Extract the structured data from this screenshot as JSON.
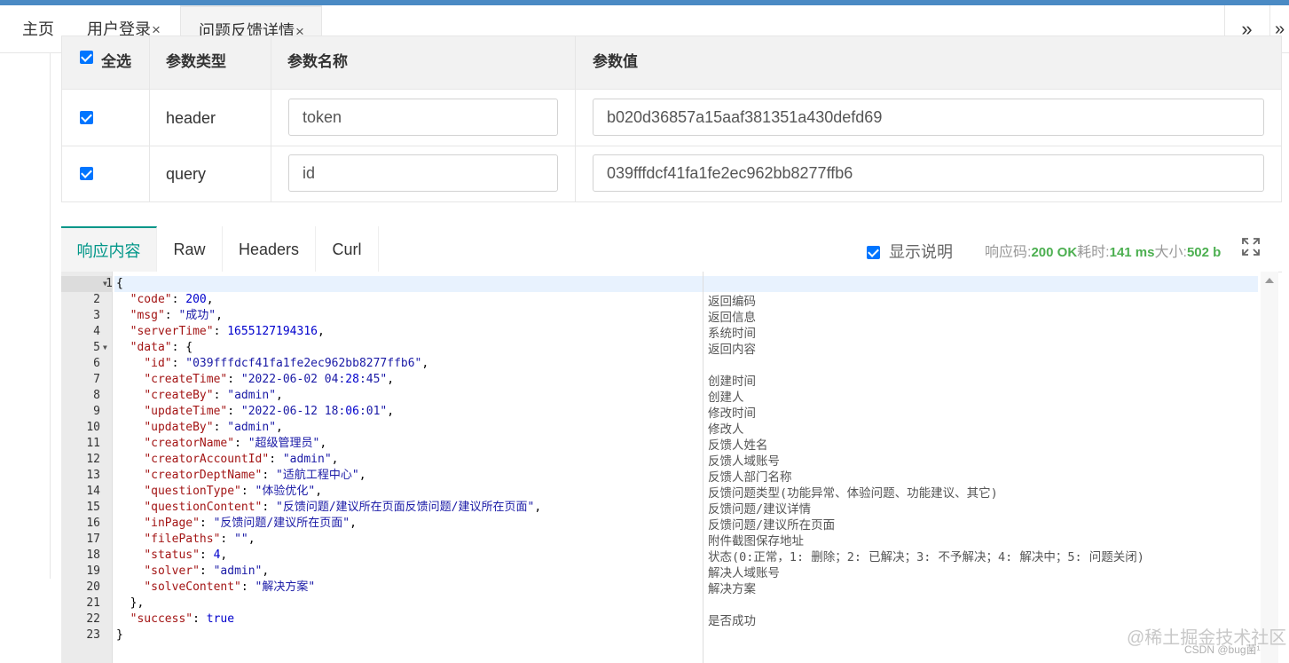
{
  "tabs": {
    "home": "主页",
    "login": "用户登录",
    "detail": "问题反馈详情",
    "close": "×",
    "more": "»",
    "more2": "»"
  },
  "params": {
    "headers": [
      "全选",
      "参数类型",
      "参数名称",
      "参数值"
    ],
    "rows": [
      {
        "type": "header",
        "name": "token",
        "value": "b020d36857a15aaf381351a430defd69"
      },
      {
        "type": "query",
        "name": "id",
        "value": "039fffdcf41fa1fe2ec962bb8277ffb6"
      }
    ]
  },
  "response": {
    "tabs": [
      "响应内容",
      "Raw",
      "Headers",
      "Curl"
    ],
    "show_desc": "显示说明",
    "status_label": "响应码:",
    "status_value": "200 OK",
    "time_label": "耗时:",
    "time_value": "141 ms",
    "size_label": "大小:",
    "size_value": "502 b"
  },
  "code_lines": [
    "{",
    "  \"code\": 200,",
    "  \"msg\": \"成功\",",
    "  \"serverTime\": 1655127194316,",
    "  \"data\": {",
    "    \"id\": \"039fffdcf41fa1fe2ec962bb8277ffb6\",",
    "    \"createTime\": \"2022-06-02 04:28:45\",",
    "    \"createBy\": \"admin\",",
    "    \"updateTime\": \"2022-06-12 18:06:01\",",
    "    \"updateBy\": \"admin\",",
    "    \"creatorName\": \"超级管理员\",",
    "    \"creatorAccountId\": \"admin\",",
    "    \"creatorDeptName\": \"适航工程中心\",",
    "    \"questionType\": \"体验优化\",",
    "    \"questionContent\": \"反馈问题/建议所在页面反馈问题/建议所在页面\",",
    "    \"inPage\": \"反馈问题/建议所在页面\",",
    "    \"filePaths\": \"\",",
    "    \"status\": 4,",
    "    \"solver\": \"admin\",",
    "    \"solveContent\": \"解决方案\"",
    "  },",
    "  \"success\": true",
    "}"
  ],
  "descriptions": [
    "",
    "返回编码",
    "返回信息",
    "系统时间",
    "返回内容",
    "",
    "创建时间",
    "创建人",
    "修改时间",
    "修改人",
    "反馈人姓名",
    "反馈人域账号",
    "反馈人部门名称",
    "反馈问题类型(功能异常、体验问题、功能建议、其它)",
    "反馈问题/建议详情",
    "反馈问题/建议所在页面",
    "附件截图保存地址",
    "状态(0:正常，1: 删除；2: 已解决；3: 不予解决；4: 解决中；5: 问题关闭)",
    "解决人域账号",
    "解决方案",
    "",
    "是否成功",
    ""
  ],
  "watermark": "@稀土掘金技术社区",
  "watermark2": "CSDN @bug菌¹",
  "colors": {
    "accent": "#009688",
    "topbar": "#4a8ac4",
    "status_green": "#4caf50",
    "checkbox": "#0075ff"
  }
}
